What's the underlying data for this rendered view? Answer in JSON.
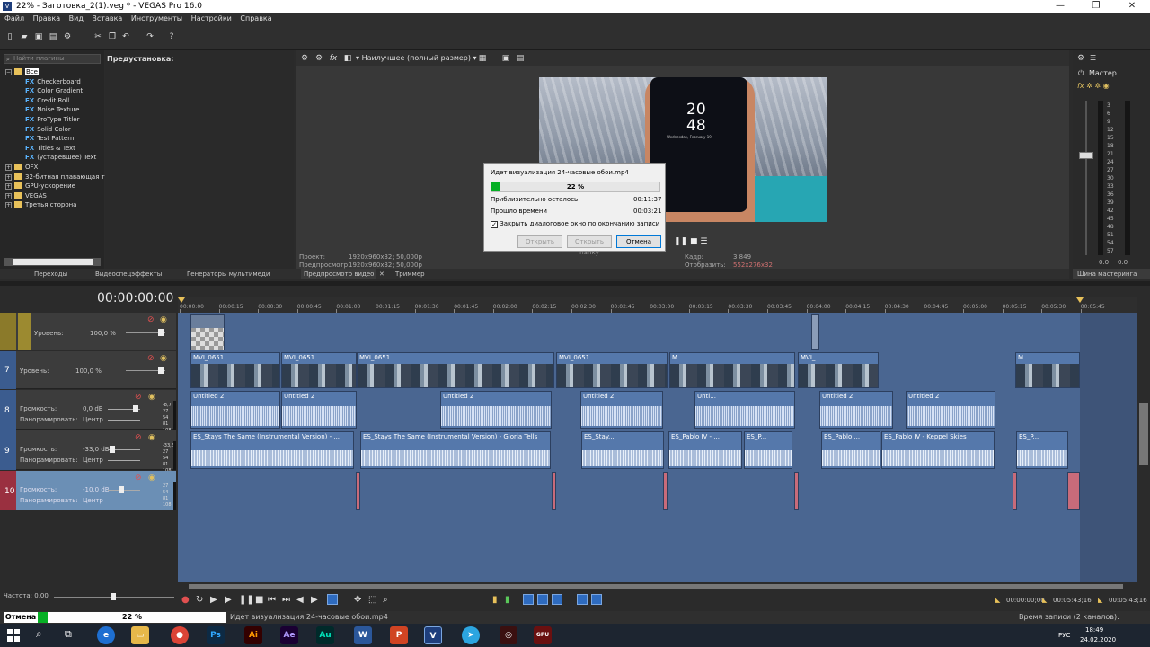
{
  "window": {
    "title": "22% - Заготовка_2(1).veg * - VEGAS Pro 16.0",
    "controls": [
      "—",
      "❐",
      "✕"
    ]
  },
  "menu": [
    "Файл",
    "Правка",
    "Вид",
    "Вставка",
    "Инструменты",
    "Настройки",
    "Справка"
  ],
  "plugins": {
    "search_placeholder": "Найти плагины",
    "preset_label": "Предустановка:",
    "tree": [
      {
        "kind": "root",
        "label": "Все"
      },
      {
        "kind": "fx",
        "label": "Checkerboard"
      },
      {
        "kind": "fx",
        "label": "Color Gradient"
      },
      {
        "kind": "fx",
        "label": "Credit Roll"
      },
      {
        "kind": "fx",
        "label": "Noise Texture"
      },
      {
        "kind": "fx",
        "label": "ProType Titler"
      },
      {
        "kind": "fx",
        "label": "Solid Color"
      },
      {
        "kind": "fx",
        "label": "Test Pattern"
      },
      {
        "kind": "fx",
        "label": "Titles & Text"
      },
      {
        "kind": "fx",
        "label": "(устаревшее) Text"
      },
      {
        "kind": "group",
        "label": "OFX"
      },
      {
        "kind": "group",
        "label": "32-битная плавающая т"
      },
      {
        "kind": "group",
        "label": "GPU-ускорение"
      },
      {
        "kind": "group",
        "label": "VEGAS"
      },
      {
        "kind": "group",
        "label": "Третья сторона"
      }
    ],
    "tabs": [
      "Переходы",
      "Видеоспецэффекты",
      "Генераторы мультимеди"
    ]
  },
  "preview": {
    "quality": "Наилучшее (полный размер)",
    "phone_time_h": "20",
    "phone_time_m": "48",
    "phone_date": "Wednesday, February 19",
    "project_label": "Проект:",
    "project_value": "1920x960x32; 50,000p",
    "preview_label": "Предпросмотр:",
    "preview_value": "1920x960x32; 50,000p",
    "frame_label": "Кадр:",
    "frame_value": "3 849",
    "display_label": "Отобразить:",
    "display_value": "552x276x32",
    "tabs": [
      "Предпросмотр видео",
      "Триммер"
    ]
  },
  "render_dialog": {
    "title": "Идет визуализация 24-часовые обои.mp4",
    "percent": "22 %",
    "progress": 0.22,
    "remaining_label": "Приблизительно осталось",
    "remaining_value": "00:11:37",
    "elapsed_label": "Прошло времени",
    "elapsed_value": "00:03:21",
    "close_label": "Закрыть диалоговое окно по окончанию записи",
    "open_btn": "Открыть",
    "open_folder_btn": "Открыть папку",
    "cancel_btn": "Отмена"
  },
  "master": {
    "label": "Мастер",
    "scale": [
      "3",
      "6",
      "9",
      "12",
      "15",
      "18",
      "21",
      "24",
      "27",
      "30",
      "33",
      "36",
      "39",
      "42",
      "45",
      "48",
      "51",
      "54",
      "57"
    ],
    "left_val": "0.0",
    "right_val": "0.0",
    "tab": "Шина мастеринга"
  },
  "timeline": {
    "timecode": "00:00:00:00",
    "ruler": [
      "00:00:00",
      "00:00:15",
      "00:00:30",
      "00:00:45",
      "00:01:00",
      "00:01:15",
      "00:01:30",
      "00:01:45",
      "00:02:00",
      "00:02:15",
      "00:02:30",
      "00:02:45",
      "00:03:00",
      "00:03:15",
      "00:03:30",
      "00:03:45",
      "00:04:00",
      "00:04:15",
      "00:04:30",
      "00:04:45",
      "00:05:00",
      "00:05:15",
      "00:05:30",
      "00:05:45"
    ],
    "tracks": [
      {
        "num": "",
        "kind": "video",
        "label": "Уровень:",
        "value": "100,0 %"
      },
      {
        "num": "7",
        "kind": "video",
        "label": "Уровень:",
        "value": "100,0 %"
      },
      {
        "num": "8",
        "kind": "audio",
        "label": "Громкость:",
        "value": "0,0 dB",
        "pan_label": "Панорамировать:",
        "pan_value": "Центр",
        "meter": [
          "-8,7",
          "27",
          "54",
          "81",
          "108"
        ]
      },
      {
        "num": "9",
        "kind": "audio",
        "label": "Громкость:",
        "value": "-33,0 dB",
        "pan_label": "Панорамировать:",
        "pan_value": "Центр",
        "meter": [
          "-33,6",
          "27",
          "54",
          "81",
          "108"
        ]
      },
      {
        "num": "10",
        "kind": "audio",
        "label": "Громкость:",
        "value": "-10,0 dB",
        "pan_label": "Панорамировать:",
        "pan_value": "Центр",
        "meter": [
          "27",
          "54",
          "81",
          "108"
        ]
      }
    ],
    "video_clips": [
      {
        "label": "MVI_0651"
      },
      {
        "label": "MVI_0651"
      },
      {
        "label": "MVI_0651"
      },
      {
        "label": "MVI_0651"
      },
      {
        "label": "M"
      },
      {
        "label": "MVI_..."
      },
      {
        "label": "M..."
      }
    ],
    "audio1_clips": [
      {
        "label": "Untitled 2"
      },
      {
        "label": "Untitled 2"
      },
      {
        "label": "Untitled 2"
      },
      {
        "label": "Untitled 2"
      },
      {
        "label": "Unti..."
      },
      {
        "label": "Untitled 2"
      },
      {
        "label": "Untitled 2"
      }
    ],
    "audio2_clips": [
      {
        "label": "ES_Stays The Same (Instrumental Version) - ..."
      },
      {
        "label": "ES_Stays The Same (Instrumental Version) - Gloria Tells"
      },
      {
        "label": "ES_Stay..."
      },
      {
        "label": "ES_Pablo IV - ..."
      },
      {
        "label": "ES_P..."
      },
      {
        "label": "ES_Pablo ..."
      },
      {
        "label": "ES_Pablo IV - Keppel Skies"
      },
      {
        "label": "ES_P..."
      }
    ],
    "rate_label": "Частота: 0,00"
  },
  "transport": {
    "time1": "00:00:00;00",
    "time2": "00:05:43;16",
    "time3": "00:05:43;16"
  },
  "status": {
    "cancel": "Отмена",
    "percent": "22 %",
    "progress": 0.22,
    "message": "Идет визуализация 24-часовые обои.mp4",
    "record_time": "Время записи (2 каналов): 209:42:25"
  },
  "taskbar": {
    "lang": "РУС",
    "time": "18:49",
    "date": "24.02.2020",
    "apps": [
      "Ps",
      "Ai",
      "Ae",
      "Au",
      "W",
      "P",
      "V"
    ]
  },
  "colors": {
    "accent": "#06b025",
    "track_blue": "#4a6691",
    "clip_blue": "#5578ab"
  }
}
